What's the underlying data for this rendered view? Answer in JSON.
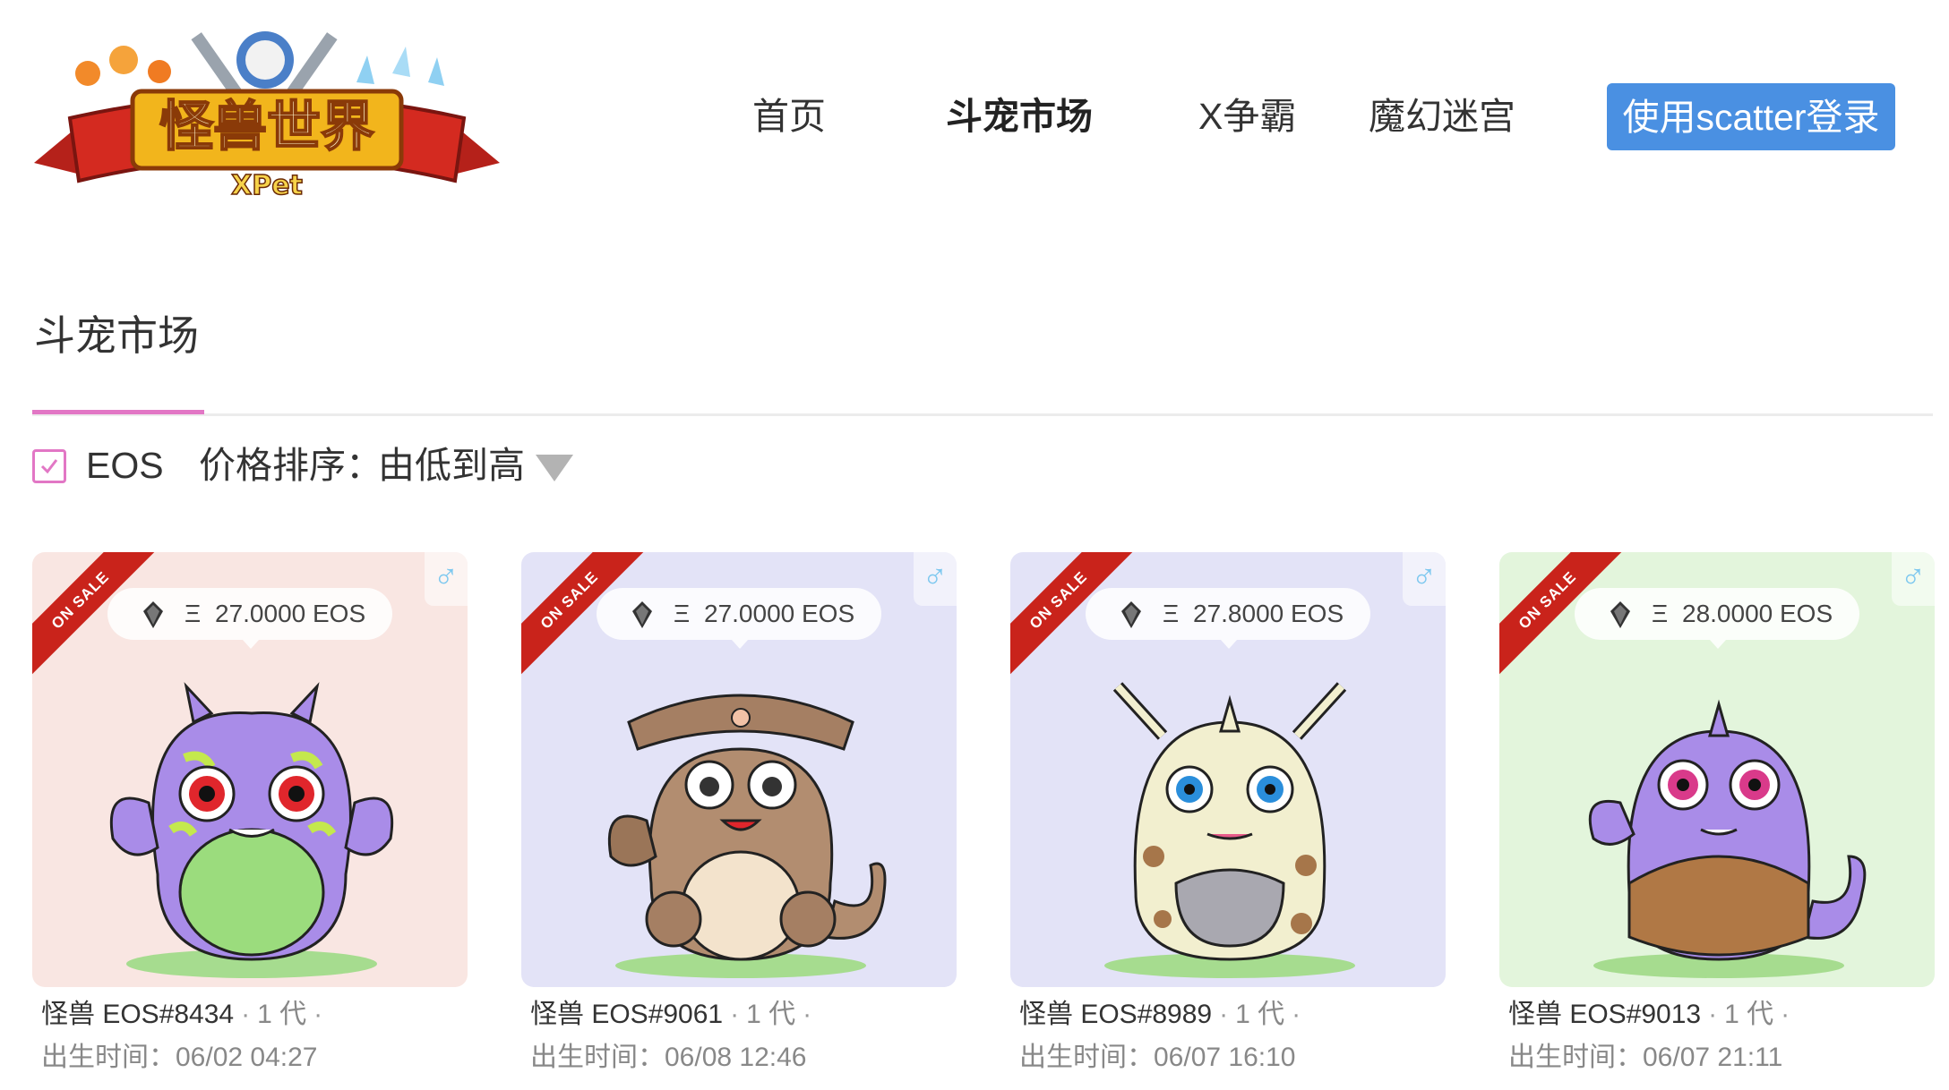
{
  "brand": {
    "logo_text": "怪兽世界",
    "logo_sub": "XPet"
  },
  "nav": {
    "items": [
      {
        "label": "首页",
        "active": false
      },
      {
        "label": "斗宠市场",
        "active": true
      },
      {
        "label": "X争霸",
        "active": false
      },
      {
        "label": "魔幻迷宫",
        "active": false
      }
    ],
    "login_label": "使用scatter登录"
  },
  "page": {
    "title": "斗宠市场"
  },
  "filter": {
    "currency_label": "EOS",
    "currency_checked": true,
    "sort_label": "价格排序：",
    "sort_value": "由低到高"
  },
  "colors": {
    "accent_pink": "#e277c5",
    "login_blue": "#4a90e2",
    "ribbon_red": "#c9231b",
    "gender_blue": "#7ec8ef"
  },
  "cards": [
    {
      "ribbon": "ON SALE",
      "gender_icon": "male-icon",
      "gender_symbol": "♂",
      "currency_symbol": "Ξ",
      "price": "27.0000 EOS",
      "name": "怪兽 EOS#8434",
      "generation": "1 代",
      "birth": "出生时间：06/02 04:27",
      "bg_color": "#f9e6e2"
    },
    {
      "ribbon": "ON SALE",
      "gender_icon": "male-icon",
      "gender_symbol": "♂",
      "currency_symbol": "Ξ",
      "price": "27.0000 EOS",
      "name": "怪兽 EOS#9061",
      "generation": "1 代",
      "birth": "出生时间：06/08 12:46",
      "bg_color": "#e3e3f7"
    },
    {
      "ribbon": "ON SALE",
      "gender_icon": "male-icon",
      "gender_symbol": "♂",
      "currency_symbol": "Ξ",
      "price": "27.8000 EOS",
      "name": "怪兽 EOS#8989",
      "generation": "1 代",
      "birth": "出生时间：06/07 16:10",
      "bg_color": "#e3e3f7"
    },
    {
      "ribbon": "ON SALE",
      "gender_icon": "male-icon",
      "gender_symbol": "♂",
      "currency_symbol": "Ξ",
      "price": "28.0000 EOS",
      "name": "怪兽 EOS#9013",
      "generation": "1 代",
      "birth": "出生时间：06/07 21:11",
      "bg_color": "#e3f5dc"
    }
  ]
}
